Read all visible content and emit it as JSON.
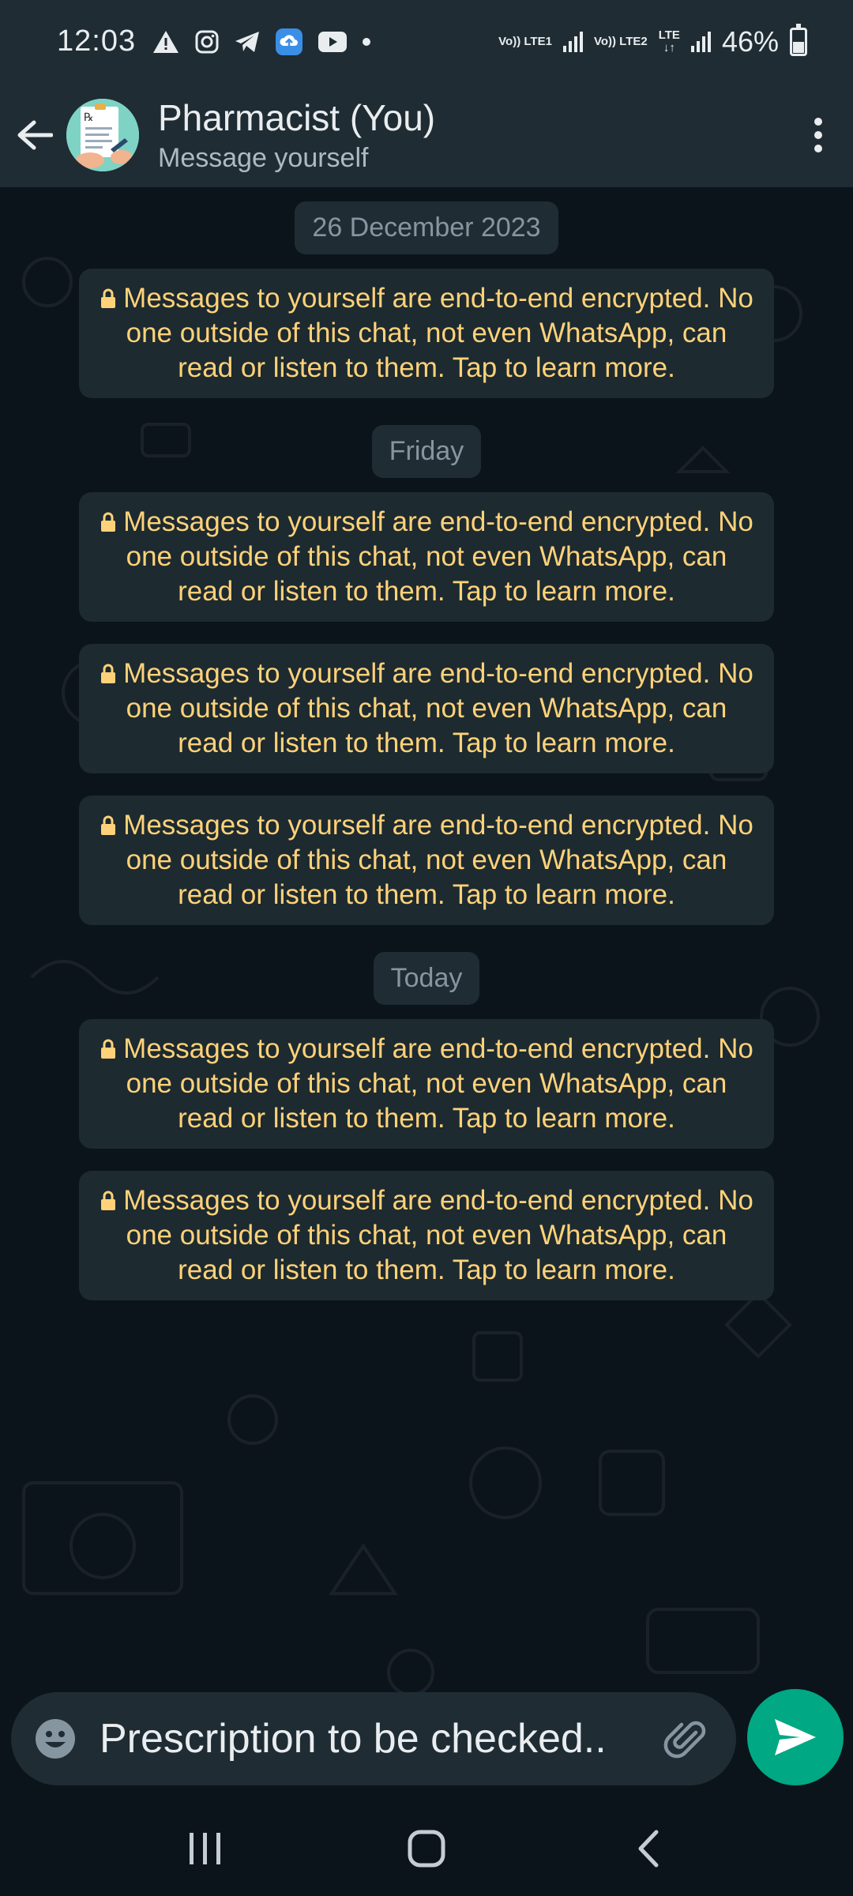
{
  "status_bar": {
    "time": "12:03",
    "network1": "Vo)) LTE1",
    "network2": "Vo)) LTE2",
    "lte": "LTE",
    "battery": "46%"
  },
  "header": {
    "title": "Pharmacist (You)",
    "subtitle": "Message yourself"
  },
  "chat": {
    "groups": [
      {
        "date": "26 December 2023",
        "count": 1
      },
      {
        "date": "Friday",
        "count": 3
      },
      {
        "date": "Today",
        "count": 2
      }
    ],
    "encryption_notice": "Messages to yourself are end-to-end encrypted. No one outside of this chat, not even WhatsApp, can read or listen to them. Tap to learn more."
  },
  "input": {
    "value": "Prescription to be checked.."
  },
  "colors": {
    "accent": "#00a884",
    "notice_text": "#ffd279",
    "bar_bg": "#1f2c34",
    "chat_bg": "#0b141a"
  }
}
